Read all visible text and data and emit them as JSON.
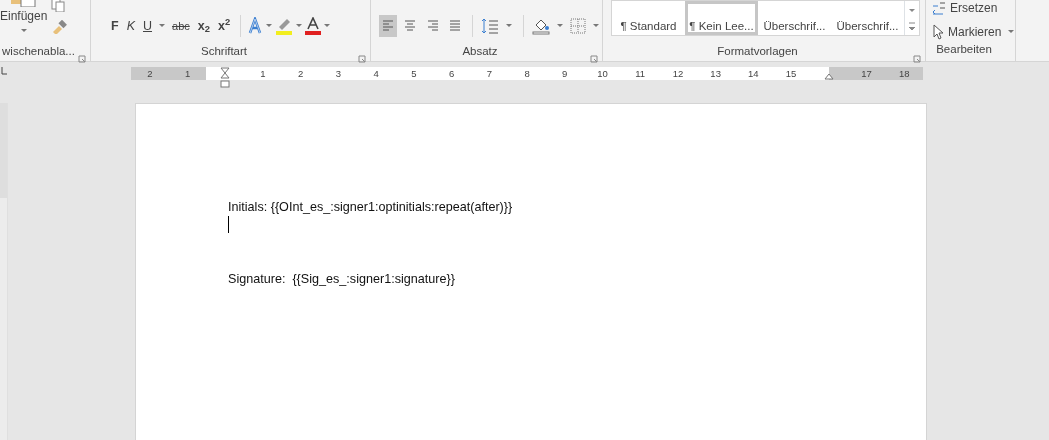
{
  "ribbon": {
    "clipboard": {
      "paste_label": "Einfügen",
      "group_label": "wischenabla..."
    },
    "font": {
      "group_label": "Schriftart",
      "buttons": [
        {
          "kind": "bold",
          "label": "F"
        },
        {
          "kind": "italic",
          "label": "K"
        },
        {
          "kind": "underline",
          "label": "U"
        },
        {
          "kind": "strike",
          "label": "abc"
        },
        {
          "kind": "sub",
          "label": "x$_{2}$"
        },
        {
          "kind": "sup",
          "label": "x$^{2}$"
        }
      ]
    },
    "paragraph": {
      "group_label": "Absatz",
      "align": [
        {
          "selected": true
        },
        {
          "selected": false
        },
        {
          "selected": false
        },
        {
          "selected": false
        }
      ]
    },
    "styles": {
      "group_label": "Formatvorlagen",
      "items": [
        {
          "label": "¶ Standard",
          "selected": false
        },
        {
          "label": "¶ Kein Lee...",
          "selected": true
        },
        {
          "label": "Überschrif...",
          "selected": false
        },
        {
          "label": "Überschrif...",
          "selected": false
        }
      ]
    },
    "editing": {
      "group_label": "Bearbeiten",
      "items": [
        {
          "kind": "replace",
          "label": "Ersetzen"
        },
        {
          "kind": "select",
          "label": "Markieren"
        }
      ]
    }
  },
  "ruler": {
    "cells": [
      {
        "kind": "number",
        "label": "2",
        "margin": true
      },
      {
        "kind": "number",
        "label": "1",
        "margin": true
      },
      {
        "kind": "indent"
      },
      {
        "kind": "number",
        "label": "1",
        "margin": false
      },
      {
        "kind": "number",
        "label": "2",
        "margin": false
      },
      {
        "kind": "number",
        "label": "3",
        "margin": false
      },
      {
        "kind": "number",
        "label": "4",
        "margin": false
      },
      {
        "kind": "number",
        "label": "5",
        "margin": false
      },
      {
        "kind": "number",
        "label": "6",
        "margin": false
      },
      {
        "kind": "number",
        "label": "7",
        "margin": false
      },
      {
        "kind": "number",
        "label": "8",
        "margin": false
      },
      {
        "kind": "number",
        "label": "9",
        "margin": false
      },
      {
        "kind": "number",
        "label": "10",
        "margin": false
      },
      {
        "kind": "number",
        "label": "11",
        "margin": false
      },
      {
        "kind": "number",
        "label": "12",
        "margin": false
      },
      {
        "kind": "number",
        "label": "13",
        "margin": false
      },
      {
        "kind": "number",
        "label": "14",
        "margin": false
      },
      {
        "kind": "number",
        "label": "15",
        "margin": false
      },
      {
        "kind": "right-indent"
      },
      {
        "kind": "number",
        "label": "17",
        "margin": true
      },
      {
        "kind": "number",
        "label": "18",
        "margin": true
      }
    ]
  },
  "document": {
    "blocks": [
      {
        "kind": "text",
        "text": "Initials: {{OInt_es_:signer1:optinitials:repeat(after)}}"
      },
      {
        "kind": "cursor"
      },
      {
        "kind": "blank"
      },
      {
        "kind": "blank"
      },
      {
        "kind": "text",
        "text": "Signature:  {{Sig_es_:signer1:signature}}"
      }
    ]
  }
}
